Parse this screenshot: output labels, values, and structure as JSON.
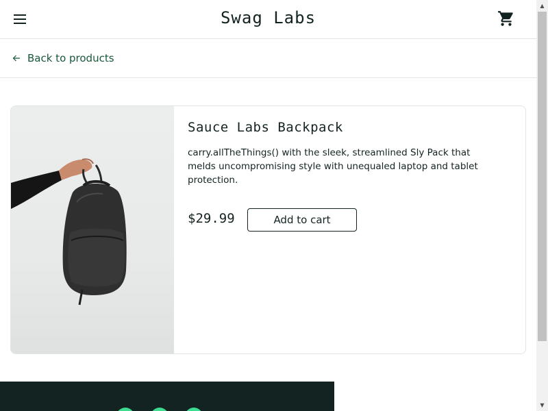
{
  "header": {
    "app_logo": "Swag Labs",
    "menu_icon": "hamburger-menu-icon",
    "cart_icon": "shopping-cart-icon"
  },
  "subheader": {
    "back_label": "Back to products",
    "back_icon": "arrow-left-icon"
  },
  "product": {
    "name": "Sauce Labs Backpack",
    "description": "carry.allTheThings() with the sleek, streamlined Sly Pack that melds uncompromising style with unequaled laptop and tablet protection.",
    "price": "$29.99",
    "add_to_cart_label": "Add to cart",
    "image": "backpack-photo"
  },
  "footer": {
    "social_icons": [
      "twitter-icon",
      "facebook-icon",
      "linkedin-icon"
    ]
  },
  "colors": {
    "text": "#132322",
    "accent_green": "#18583a",
    "footer_bg": "#132322",
    "social_green": "#3ddc91",
    "border": "#e2e4e4"
  }
}
